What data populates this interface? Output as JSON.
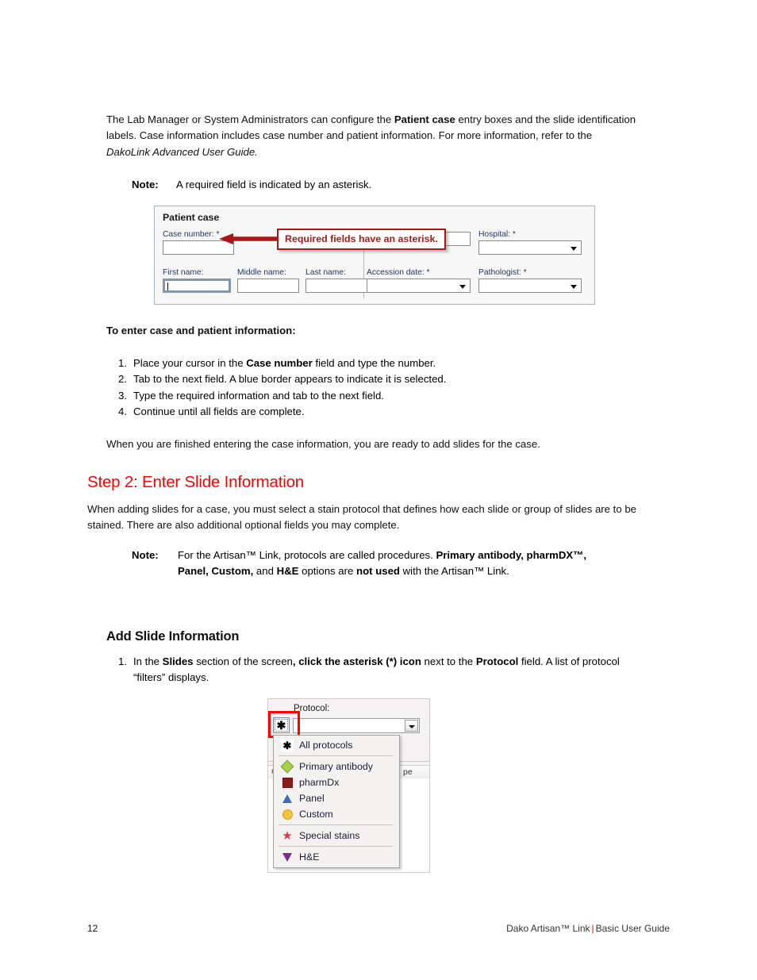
{
  "document": {
    "intro_paragraph": "The Lab Manager or System Administrators can configure the Patient case entry boxes and the slide identification labels. Case information includes case number and patient information. For more information, refer to the DakoLink Advanced User Guide.",
    "intro_parts": {
      "p1": "The Lab Manager or System Administrators can configure the ",
      "bold1": "Patient case",
      "p2": " entry boxes and the slide identification labels. Case information includes case number and patient information. For more information, refer to the ",
      "italic1": "DakoLink Advanced User Guide."
    },
    "note1": {
      "label": "Note:",
      "text": "A required field is indicated by an asterisk."
    },
    "to_enter_heading": "To enter case and patient information:",
    "steps": [
      {
        "num": "1.",
        "pre": "Place your cursor in the ",
        "bold": "Case number",
        "post": " field and type the number."
      },
      {
        "num": "2.",
        "pre": "Tab to the next field. A blue border appears to indicate it is selected.",
        "bold": "",
        "post": ""
      },
      {
        "num": "3.",
        "pre": "Type the required information and tab to the next field.",
        "bold": "",
        "post": ""
      },
      {
        "num": "4.",
        "pre": "Continue until all fields are complete.",
        "bold": "",
        "post": ""
      }
    ],
    "finished_paragraph": "When you are finished entering the case information, you are ready to add slides for the case.",
    "step2_heading": "Step 2: Enter Slide Information",
    "step2_paragraph": "When adding slides for a case, you must select a stain protocol that defines how each slide or group of slides are to be stained. There are also additional optional fields you may complete.",
    "note2": {
      "label": "Note:",
      "p1": "For the Artisan™ Link, protocols are called procedures. ",
      "b1": "Primary antibody,",
      "b2": "pharmDX™, Panel, Custom,",
      "p2": " and ",
      "b3": "H&E",
      "p3": " options are ",
      "b4": "not used",
      "p4": " with the Artisan™ Link."
    },
    "add_slide_heading": "Add Slide Information",
    "slide_steps": [
      {
        "num": "1.",
        "p1": "In the ",
        "b1": "Slides",
        "p2": " section of the screen",
        "p2b": ", click the ",
        "b2": "asterisk (*) icon",
        "p3": " next to the ",
        "b3": "Protocol",
        "p4": " field. A list of protocol “filters” displays."
      }
    ]
  },
  "patient_case_screenshot": {
    "title": "Patient case",
    "callout_text": "Required fields have an asterisk.",
    "callout_color": "#b01616",
    "fields_row1": [
      {
        "label": "Case number: *",
        "type": "text",
        "value": "",
        "required": true
      },
      {
        "label": "",
        "type": "text",
        "value": "",
        "required": false
      },
      {
        "label": "Hospital: *",
        "type": "dropdown",
        "value": "",
        "required": true
      }
    ],
    "fields_row2": [
      {
        "label": "First name:",
        "type": "text",
        "value": "",
        "required": false,
        "focused": true
      },
      {
        "label": "Middle name:",
        "type": "text",
        "value": "",
        "required": false
      },
      {
        "label": "Last name:",
        "type": "text",
        "value": "",
        "required": false
      },
      {
        "label": "Accession date: *",
        "type": "dropdown",
        "value": "",
        "required": true
      },
      {
        "label": "Pathologist: *",
        "type": "dropdown",
        "value": "",
        "required": true
      }
    ]
  },
  "protocol_screenshot": {
    "protocol_label": "Protocol:",
    "asterisk_button_glyph": "✱",
    "combo_value": "",
    "grid_col1": "#",
    "grid_col2": "pe",
    "menu_items": [
      {
        "label": "All protocols",
        "icon": "asterisk-icon",
        "glyph": "✱"
      },
      {
        "label": "Primary antibody",
        "icon": "green-diamond-icon",
        "color": "#a8d04a"
      },
      {
        "label": "pharmDx",
        "icon": "dark-red-square-icon",
        "color": "#8b1a1a"
      },
      {
        "label": "Panel",
        "icon": "blue-triangle-icon",
        "color": "#3a6fb5"
      },
      {
        "label": "Custom",
        "icon": "yellow-circle-icon",
        "color": "#f2c33c"
      },
      {
        "label": "Special stains",
        "icon": "red-star-icon",
        "color": "#e8343f",
        "glyph": "★"
      },
      {
        "label": "H&E",
        "icon": "purple-down-triangle-icon",
        "color": "#7b2d8e"
      }
    ]
  },
  "footer": {
    "page_number": "12",
    "product": "Dako Artisan™ Link",
    "separator": "|",
    "guide": "Basic User Guide",
    "separator_color": "#ff0000"
  }
}
